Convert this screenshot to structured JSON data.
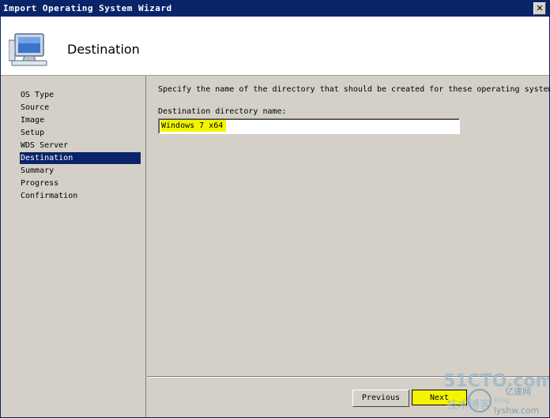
{
  "window": {
    "title": "Import Operating System Wizard",
    "close_glyph": "✕"
  },
  "header": {
    "title": "Destination",
    "icon": "computer-icon"
  },
  "sidebar": {
    "items": [
      {
        "label": "OS Type",
        "active": false
      },
      {
        "label": "Source",
        "active": false
      },
      {
        "label": "Image",
        "active": false
      },
      {
        "label": "Setup",
        "active": false
      },
      {
        "label": "WDS Server",
        "active": false
      },
      {
        "label": "Destination",
        "active": true
      },
      {
        "label": "Summary",
        "active": false
      },
      {
        "label": "Progress",
        "active": false
      },
      {
        "label": "Confirmation",
        "active": false
      }
    ]
  },
  "main": {
    "instruction": "Specify the name of the directory that should be created for these operating system fi",
    "field_label": "Destination directory name:",
    "field_value": "Windows 7 x64"
  },
  "footer": {
    "previous_label": "Previous",
    "next_label": "Next"
  },
  "watermark": {
    "line1": "51CTO.com",
    "line2": "技术博客",
    "line3": "Blog",
    "line4": "亿速网",
    "line5": "lyshw.com"
  },
  "colors": {
    "titlebar": "#0a246a",
    "selection": "#0a246a",
    "highlight": "#f4f400",
    "watermark": "#9fb9c9"
  }
}
